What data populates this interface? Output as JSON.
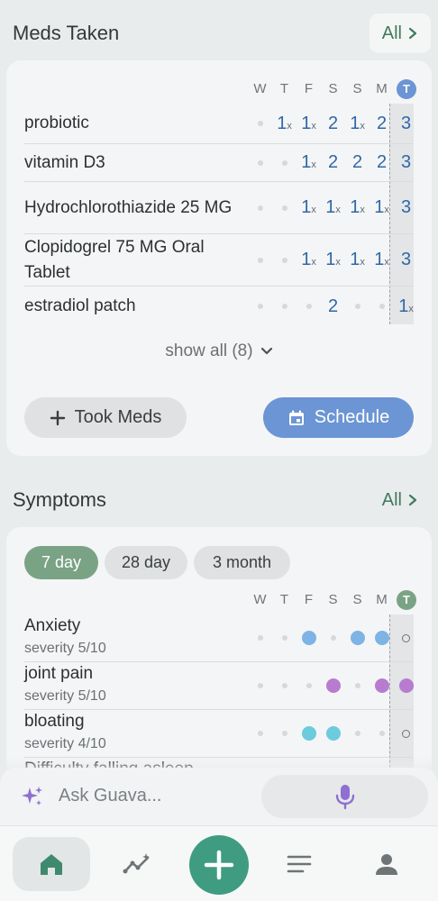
{
  "meds": {
    "title": "Meds Taken",
    "all_label": "All",
    "days": [
      "W",
      "T",
      "F",
      "S",
      "S",
      "M"
    ],
    "today_letter": "T",
    "today_color": "#6b95d4",
    "rows": [
      {
        "name": "probiotic",
        "cells": [
          ".",
          "1x",
          "1x",
          "2",
          "1x",
          "2"
        ],
        "today": "3"
      },
      {
        "name": "vitamin D3",
        "cells": [
          ".",
          ".",
          "1x",
          "2",
          "2",
          "2"
        ],
        "today": "3"
      },
      {
        "name": "Hydrochlorothiazide 25 MG",
        "cells": [
          ".",
          ".",
          "1x",
          "1x",
          "1x",
          "1x"
        ],
        "today": "3"
      },
      {
        "name": "Clopidogrel 75 MG Oral Tablet",
        "cells": [
          ".",
          ".",
          "1x",
          "1x",
          "1x",
          "1x"
        ],
        "today": "3"
      },
      {
        "name": "estradiol patch",
        "cells": [
          ".",
          ".",
          ".",
          "2",
          ".",
          "."
        ],
        "today": "1x"
      }
    ],
    "show_all_label": "show all (8)",
    "took_label": "Took Meds",
    "schedule_label": "Schedule"
  },
  "symptoms": {
    "title": "Symptoms",
    "all_label": "All",
    "ranges": [
      "7 day",
      "28 day",
      "3 month"
    ],
    "active_range": "7 day",
    "days": [
      "W",
      "T",
      "F",
      "S",
      "S",
      "M"
    ],
    "today_letter": "T",
    "today_color": "#7aa386",
    "rows": [
      {
        "name": "Anxiety",
        "severity": "severity 5/10",
        "color": "#7eb3e6",
        "cells": [
          "dot",
          "dot",
          "big",
          "dot",
          "big",
          "big"
        ],
        "today": "ring"
      },
      {
        "name": "joint pain",
        "severity": "severity 5/10",
        "color": "#b77ccf",
        "cells": [
          "dot",
          "dot",
          "dot",
          "big",
          "dot",
          "big"
        ],
        "today": "big"
      },
      {
        "name": "bloating",
        "severity": "severity 4/10",
        "color": "#6ccbdc",
        "cells": [
          "dot",
          "dot",
          "big",
          "big",
          "dot",
          "dot"
        ],
        "today": "ring"
      },
      {
        "name": "Difficulty falling asleep",
        "severity": "",
        "color": "#7eb3e6",
        "cells": [
          "dot",
          "dot",
          "dot",
          "dot",
          "dot",
          "dot"
        ],
        "today": "ring"
      }
    ]
  },
  "assistant": {
    "placeholder": "Ask Guava..."
  },
  "nav": {
    "items": [
      "home",
      "trends",
      "add",
      "log",
      "profile"
    ]
  }
}
